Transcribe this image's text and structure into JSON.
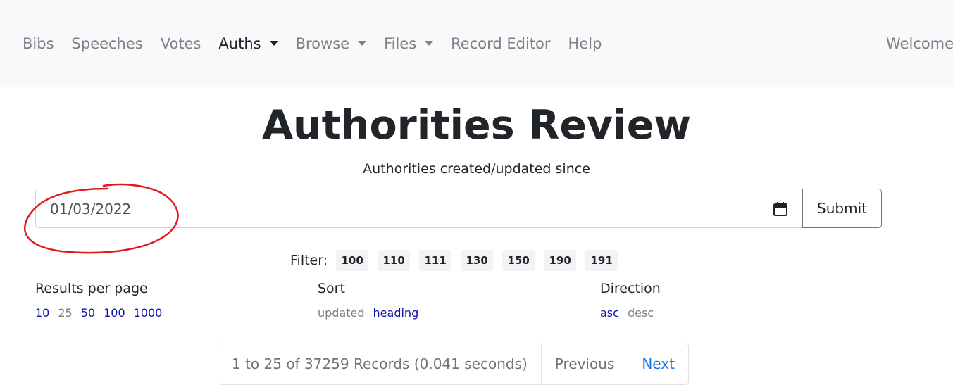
{
  "nav": {
    "items": [
      {
        "label": "Bibs",
        "dropdown": false,
        "active": false
      },
      {
        "label": "Speeches",
        "dropdown": false,
        "active": false
      },
      {
        "label": "Votes",
        "dropdown": false,
        "active": false
      },
      {
        "label": "Auths",
        "dropdown": true,
        "active": true
      },
      {
        "label": "Browse",
        "dropdown": true,
        "active": false
      },
      {
        "label": "Files",
        "dropdown": true,
        "active": false
      },
      {
        "label": "Record Editor",
        "dropdown": false,
        "active": false
      },
      {
        "label": "Help",
        "dropdown": false,
        "active": false
      }
    ],
    "welcome": "Welcome"
  },
  "page": {
    "title": "Authorities Review",
    "subtitle": "Authorities created/updated since"
  },
  "form": {
    "date_value": "01/03/2022",
    "submit_label": "Submit",
    "annotation_color": "#e0191c"
  },
  "filter": {
    "label": "Filter:",
    "tags": [
      "100",
      "110",
      "111",
      "130",
      "150",
      "190",
      "191"
    ]
  },
  "options": {
    "results_per_page": {
      "title": "Results per page",
      "values": [
        {
          "label": "10",
          "selected": false
        },
        {
          "label": "25",
          "selected": true
        },
        {
          "label": "50",
          "selected": false
        },
        {
          "label": "100",
          "selected": false
        },
        {
          "label": "1000",
          "selected": false
        }
      ]
    },
    "sort": {
      "title": "Sort",
      "values": [
        {
          "label": "updated",
          "selected": true
        },
        {
          "label": "heading",
          "selected": false
        }
      ]
    },
    "direction": {
      "title": "Direction",
      "values": [
        {
          "label": "asc",
          "selected": false
        },
        {
          "label": "desc",
          "selected": true
        }
      ]
    }
  },
  "pagination": {
    "info": "1 to 25 of 37259 Records (0.041 seconds)",
    "previous": "Previous",
    "next": "Next"
  }
}
